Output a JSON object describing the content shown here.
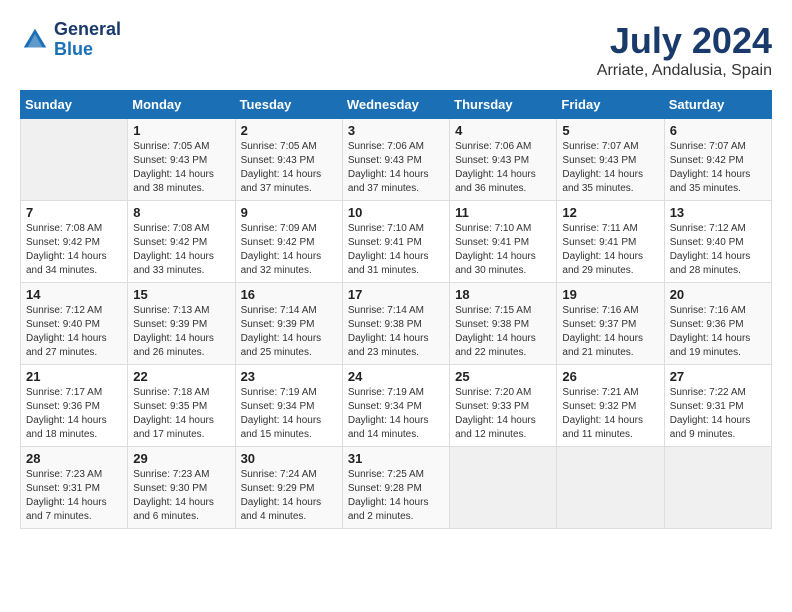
{
  "header": {
    "logo_general": "General",
    "logo_blue": "Blue",
    "title": "July 2024",
    "subtitle": "Arriate, Andalusia, Spain"
  },
  "calendar": {
    "days_of_week": [
      "Sunday",
      "Monday",
      "Tuesday",
      "Wednesday",
      "Thursday",
      "Friday",
      "Saturday"
    ],
    "weeks": [
      [
        {
          "day": "",
          "info": ""
        },
        {
          "day": "1",
          "info": "Sunrise: 7:05 AM\nSunset: 9:43 PM\nDaylight: 14 hours\nand 38 minutes."
        },
        {
          "day": "2",
          "info": "Sunrise: 7:05 AM\nSunset: 9:43 PM\nDaylight: 14 hours\nand 37 minutes."
        },
        {
          "day": "3",
          "info": "Sunrise: 7:06 AM\nSunset: 9:43 PM\nDaylight: 14 hours\nand 37 minutes."
        },
        {
          "day": "4",
          "info": "Sunrise: 7:06 AM\nSunset: 9:43 PM\nDaylight: 14 hours\nand 36 minutes."
        },
        {
          "day": "5",
          "info": "Sunrise: 7:07 AM\nSunset: 9:43 PM\nDaylight: 14 hours\nand 35 minutes."
        },
        {
          "day": "6",
          "info": "Sunrise: 7:07 AM\nSunset: 9:42 PM\nDaylight: 14 hours\nand 35 minutes."
        }
      ],
      [
        {
          "day": "7",
          "info": "Sunrise: 7:08 AM\nSunset: 9:42 PM\nDaylight: 14 hours\nand 34 minutes."
        },
        {
          "day": "8",
          "info": "Sunrise: 7:08 AM\nSunset: 9:42 PM\nDaylight: 14 hours\nand 33 minutes."
        },
        {
          "day": "9",
          "info": "Sunrise: 7:09 AM\nSunset: 9:42 PM\nDaylight: 14 hours\nand 32 minutes."
        },
        {
          "day": "10",
          "info": "Sunrise: 7:10 AM\nSunset: 9:41 PM\nDaylight: 14 hours\nand 31 minutes."
        },
        {
          "day": "11",
          "info": "Sunrise: 7:10 AM\nSunset: 9:41 PM\nDaylight: 14 hours\nand 30 minutes."
        },
        {
          "day": "12",
          "info": "Sunrise: 7:11 AM\nSunset: 9:41 PM\nDaylight: 14 hours\nand 29 minutes."
        },
        {
          "day": "13",
          "info": "Sunrise: 7:12 AM\nSunset: 9:40 PM\nDaylight: 14 hours\nand 28 minutes."
        }
      ],
      [
        {
          "day": "14",
          "info": "Sunrise: 7:12 AM\nSunset: 9:40 PM\nDaylight: 14 hours\nand 27 minutes."
        },
        {
          "day": "15",
          "info": "Sunrise: 7:13 AM\nSunset: 9:39 PM\nDaylight: 14 hours\nand 26 minutes."
        },
        {
          "day": "16",
          "info": "Sunrise: 7:14 AM\nSunset: 9:39 PM\nDaylight: 14 hours\nand 25 minutes."
        },
        {
          "day": "17",
          "info": "Sunrise: 7:14 AM\nSunset: 9:38 PM\nDaylight: 14 hours\nand 23 minutes."
        },
        {
          "day": "18",
          "info": "Sunrise: 7:15 AM\nSunset: 9:38 PM\nDaylight: 14 hours\nand 22 minutes."
        },
        {
          "day": "19",
          "info": "Sunrise: 7:16 AM\nSunset: 9:37 PM\nDaylight: 14 hours\nand 21 minutes."
        },
        {
          "day": "20",
          "info": "Sunrise: 7:16 AM\nSunset: 9:36 PM\nDaylight: 14 hours\nand 19 minutes."
        }
      ],
      [
        {
          "day": "21",
          "info": "Sunrise: 7:17 AM\nSunset: 9:36 PM\nDaylight: 14 hours\nand 18 minutes."
        },
        {
          "day": "22",
          "info": "Sunrise: 7:18 AM\nSunset: 9:35 PM\nDaylight: 14 hours\nand 17 minutes."
        },
        {
          "day": "23",
          "info": "Sunrise: 7:19 AM\nSunset: 9:34 PM\nDaylight: 14 hours\nand 15 minutes."
        },
        {
          "day": "24",
          "info": "Sunrise: 7:19 AM\nSunset: 9:34 PM\nDaylight: 14 hours\nand 14 minutes."
        },
        {
          "day": "25",
          "info": "Sunrise: 7:20 AM\nSunset: 9:33 PM\nDaylight: 14 hours\nand 12 minutes."
        },
        {
          "day": "26",
          "info": "Sunrise: 7:21 AM\nSunset: 9:32 PM\nDaylight: 14 hours\nand 11 minutes."
        },
        {
          "day": "27",
          "info": "Sunrise: 7:22 AM\nSunset: 9:31 PM\nDaylight: 14 hours\nand 9 minutes."
        }
      ],
      [
        {
          "day": "28",
          "info": "Sunrise: 7:23 AM\nSunset: 9:31 PM\nDaylight: 14 hours\nand 7 minutes."
        },
        {
          "day": "29",
          "info": "Sunrise: 7:23 AM\nSunset: 9:30 PM\nDaylight: 14 hours\nand 6 minutes."
        },
        {
          "day": "30",
          "info": "Sunrise: 7:24 AM\nSunset: 9:29 PM\nDaylight: 14 hours\nand 4 minutes."
        },
        {
          "day": "31",
          "info": "Sunrise: 7:25 AM\nSunset: 9:28 PM\nDaylight: 14 hours\nand 2 minutes."
        },
        {
          "day": "",
          "info": ""
        },
        {
          "day": "",
          "info": ""
        },
        {
          "day": "",
          "info": ""
        }
      ]
    ]
  }
}
